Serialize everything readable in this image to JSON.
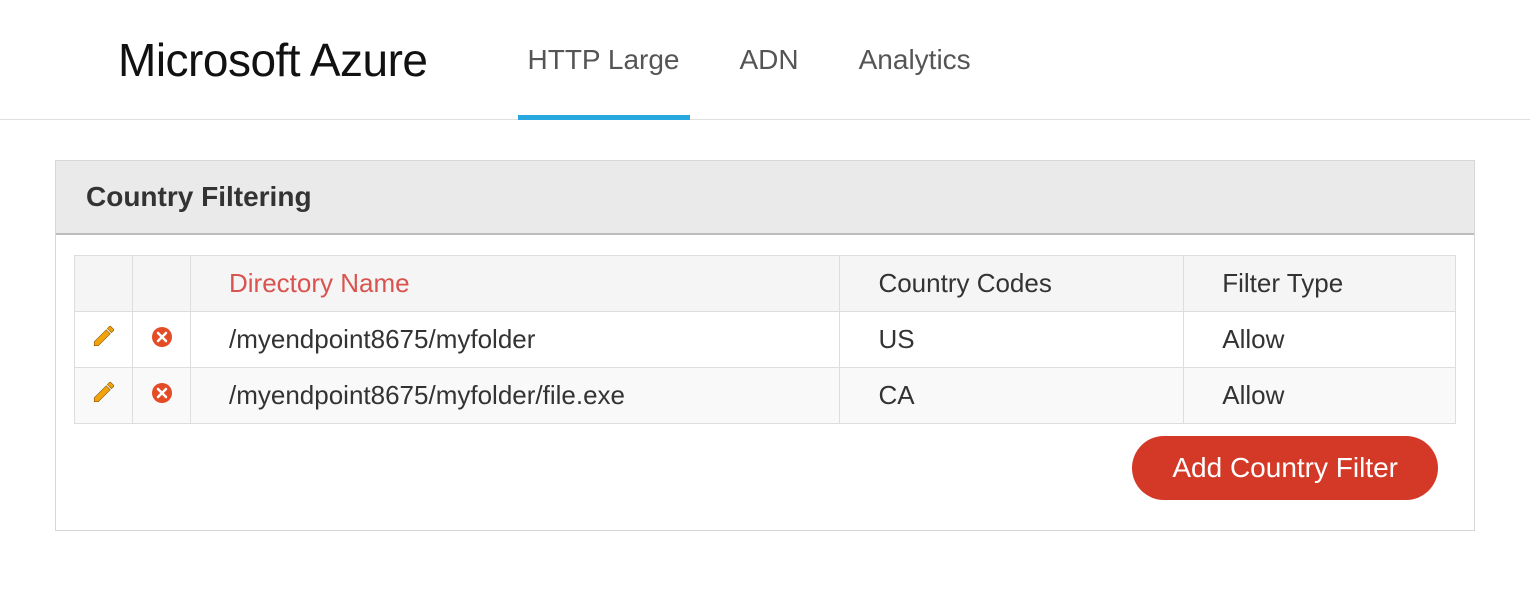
{
  "header": {
    "logo": "Microsoft Azure",
    "tabs": [
      {
        "label": "HTTP Large",
        "active": true
      },
      {
        "label": "ADN",
        "active": false
      },
      {
        "label": "Analytics",
        "active": false
      }
    ]
  },
  "panel": {
    "title": "Country Filtering",
    "columns": {
      "directory_name": "Directory Name",
      "country_codes": "Country Codes",
      "filter_type": "Filter Type"
    },
    "rows": [
      {
        "directory": "/myendpoint8675/myfolder",
        "codes": "US",
        "filter": "Allow"
      },
      {
        "directory": "/myendpoint8675/myfolder/file.exe",
        "codes": "CA",
        "filter": "Allow"
      }
    ],
    "add_button": "Add Country Filter"
  }
}
